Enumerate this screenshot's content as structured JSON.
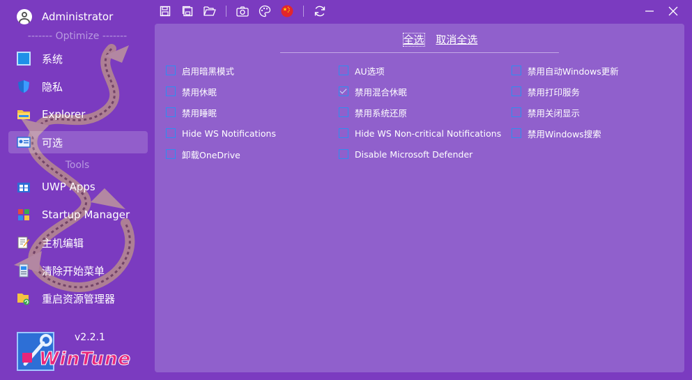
{
  "user": {
    "name": "Administrator"
  },
  "sections": {
    "optimize": "------- Optimize -------",
    "tools": "Tools"
  },
  "nav": {
    "system": "系统",
    "privacy": "隐私",
    "explorer": "Explorer",
    "optional": "可选",
    "uwp": "UWP Apps",
    "startup": "Startup Manager",
    "hosts": "主机编辑",
    "startmenu": "清除开始菜单",
    "restart": "重启资源管理器"
  },
  "brand": {
    "version": "v2.2.1",
    "logo_text": "WinTune"
  },
  "links": {
    "select_all": "全选",
    "deselect_all": "取消全选"
  },
  "options": [
    {
      "label": "启用暗黑模式",
      "checked": false
    },
    {
      "label": "AU选项",
      "checked": false
    },
    {
      "label": "禁用自动Windows更新",
      "checked": false
    },
    {
      "label": "禁用休眠",
      "checked": false
    },
    {
      "label": "禁用混合休眠",
      "checked": true
    },
    {
      "label": "禁用打印服务",
      "checked": false
    },
    {
      "label": "禁用睡眠",
      "checked": false
    },
    {
      "label": "禁用系统还原",
      "checked": false
    },
    {
      "label": "禁用关闭显示",
      "checked": false
    },
    {
      "label": "Hide WS Notifications",
      "checked": false
    },
    {
      "label": "Hide WS Non-critical Notifications",
      "checked": false
    },
    {
      "label": "禁用Windows搜索",
      "checked": false
    },
    {
      "label": "卸载OneDrive",
      "checked": false
    },
    {
      "label": "Disable Microsoft Defender",
      "checked": false
    }
  ],
  "icons": {
    "toolbar": [
      "save-icon",
      "save-all-icon",
      "folder-open-icon",
      "camera-icon",
      "palette-icon",
      "china-flag-icon",
      "refresh-icon"
    ],
    "window": [
      "minimize-icon",
      "close-icon"
    ]
  },
  "colors": {
    "background": "#7b3bc0",
    "panel": "#9060cc",
    "checkbox": "#2d8ef0",
    "logo": "#e8257a"
  }
}
